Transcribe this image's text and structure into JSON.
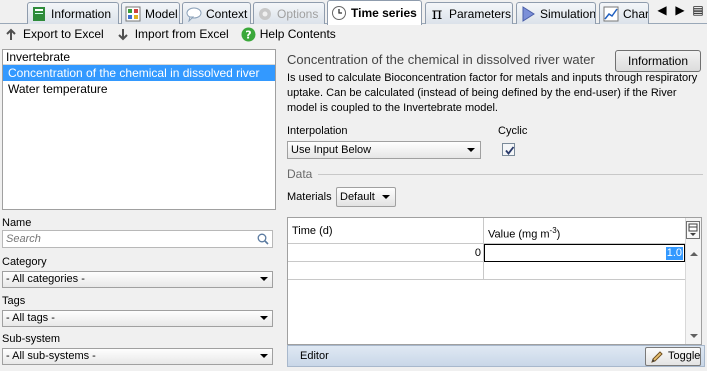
{
  "tabs": [
    {
      "label": "Information",
      "icon": "book-icon",
      "state": "normal"
    },
    {
      "label": "Model",
      "icon": "model-grid-icon",
      "state": "normal"
    },
    {
      "label": "Context",
      "icon": "speech-bubble-icon",
      "state": "normal"
    },
    {
      "label": "Options",
      "icon": "gear-icon",
      "state": "disabled"
    },
    {
      "label": "Time series",
      "icon": "clock-icon",
      "state": "active"
    },
    {
      "label": "Parameters",
      "icon": "pi-icon",
      "state": "normal"
    },
    {
      "label": "Simulation",
      "icon": "play-icon",
      "state": "normal"
    },
    {
      "label": "Charts",
      "icon": "chart-icon",
      "state": "normal"
    }
  ],
  "toolbar": {
    "export_label": "Export to Excel",
    "import_label": "Import from Excel",
    "help_label": "Help Contents"
  },
  "list": {
    "header": "Invertebrate",
    "items": [
      {
        "label": "Concentration of the chemical in dissolved river water",
        "selected": true
      },
      {
        "label": "Water temperature",
        "selected": false
      }
    ]
  },
  "filters": {
    "name_label": "Name",
    "search_placeholder": "Search",
    "category_label": "Category",
    "category_value": "- All categories -",
    "tags_label": "Tags",
    "tags_value": "- All tags -",
    "subsystem_label": "Sub-system",
    "subsystem_value": "- All sub-systems -"
  },
  "detail": {
    "title": "Concentration of the chemical in dissolved river water",
    "info_button": "Information",
    "description": "Is used to calculate Bioconcentration factor for metals and inputs through respiratory uptake. Can be calculated (instead of being defined by the end-user) if the River model is coupled to the Invertebrate model.",
    "interpolation_label": "Interpolation",
    "interpolation_value": "Use Input Below",
    "cyclic_label": "Cyclic",
    "cyclic_checked": true,
    "data_label": "Data",
    "materials_label": "Materials",
    "materials_value": "Default"
  },
  "grid": {
    "col_time": "Time (d)",
    "col_value_prefix": "Value (mg m",
    "col_value_exp": "-3",
    "col_value_suffix": ")",
    "rows": [
      {
        "time": "0",
        "value": "1.0"
      }
    ]
  },
  "editor": {
    "label": "Editor",
    "toggle_label": "Toggle"
  }
}
